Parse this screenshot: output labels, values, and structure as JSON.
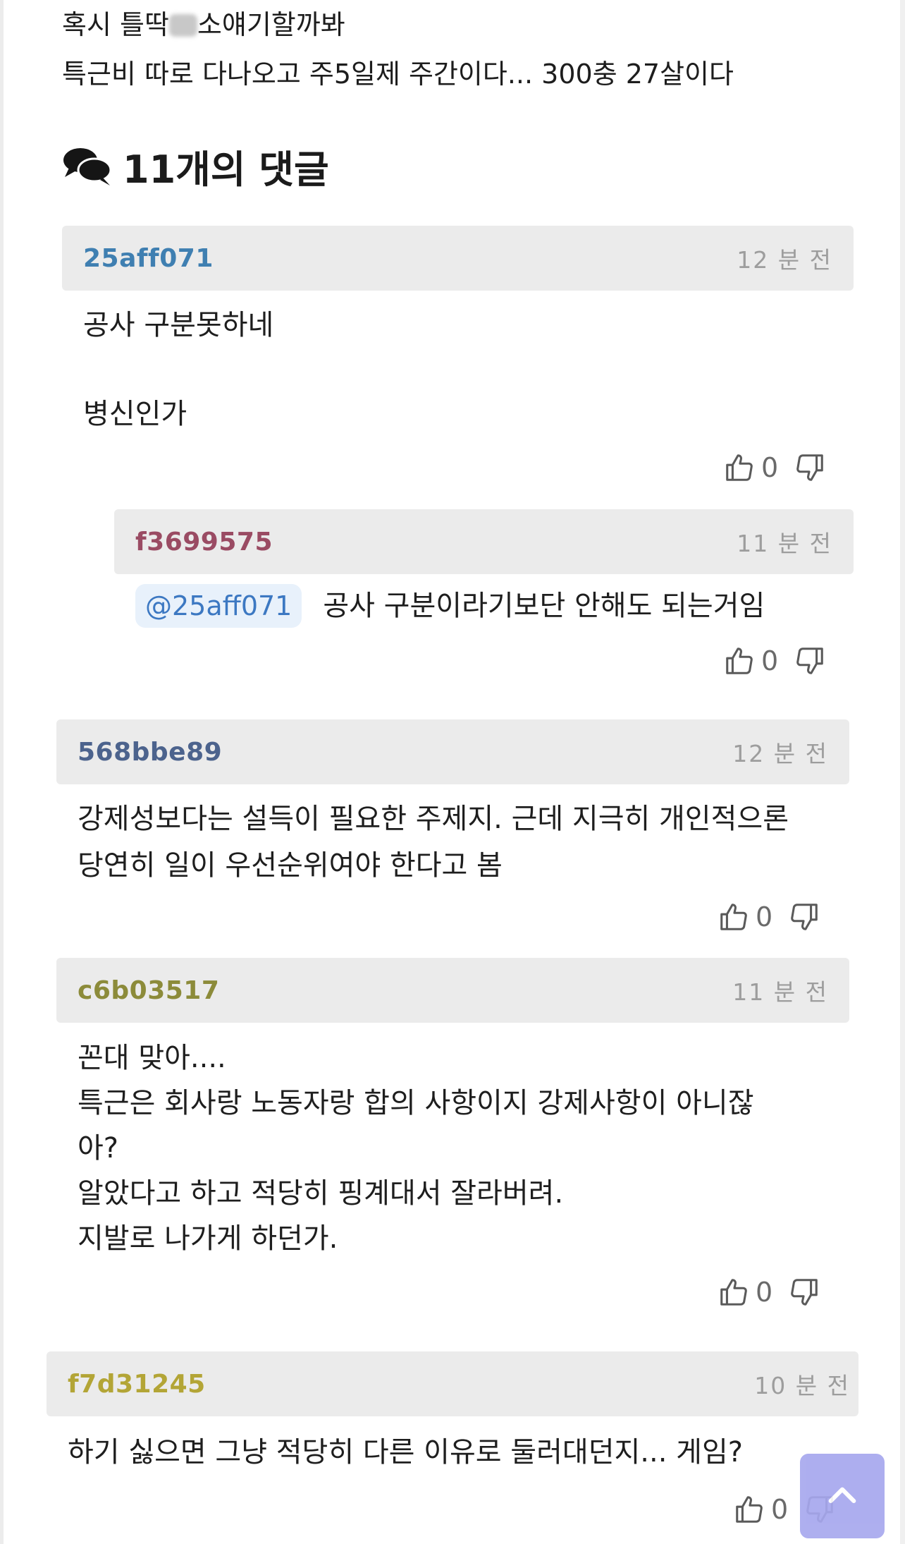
{
  "post": {
    "line1_before": "혹시 틀딱",
    "line1_after": "소얘기할까봐",
    "line2": "특근비 따로 다나오고 주5일제 주간이다... 300충  27살이다"
  },
  "comments_header": {
    "title": "11개의 댓글",
    "icon": "comments-icon"
  },
  "comments": [
    {
      "author": "25aff071",
      "author_color": "#3f7fb1",
      "time": "12 분 전",
      "lines": [
        "공사 구분못하네",
        "",
        "병신인가"
      ],
      "likes": "0"
    },
    {
      "author": "f3699575",
      "author_color": "#9a4b63",
      "time": "11 분 전",
      "mention": "@25aff071",
      "text": "공사 구분이라기보단 안해도 되는거임",
      "likes": "0"
    },
    {
      "author": "568bbe89",
      "author_color": "#4c638d",
      "time": "12 분 전",
      "lines": [
        "강제성보다는 설득이 필요한 주제지. 근데 지극히 개인적으론",
        "당연히 일이 우선순위여야 한다고 봄"
      ],
      "likes": "0"
    },
    {
      "author": "c6b03517",
      "author_color": "#8c8b3a",
      "time": "11 분 전",
      "lines": [
        "꼰대 맞아....",
        "특근은 회사랑 노동자랑 합의 사항이지 강제사항이 아니잖",
        "아?",
        "알았다고 하고 적당히 핑계대서 잘라버려.",
        "지발로 나가게 하던가."
      ],
      "likes": "0"
    },
    {
      "author": "f7d31245",
      "author_color": "#b3a536",
      "time": "10 분 전",
      "lines": [
        "하기 싫으면 그냥 적당히 다른 이유로 둘러대던지... 게임?"
      ],
      "likes": "0"
    }
  ],
  "icons": {
    "like": "thumbs-up-icon",
    "dislike": "thumbs-down-icon",
    "scroll_top": "chevron-up-icon"
  },
  "colors": {
    "meta_bg": "#ebebeb",
    "mention_bg": "#e8f1fb",
    "mention_text": "#3c78c2",
    "top_button": "#a7a8ee"
  }
}
